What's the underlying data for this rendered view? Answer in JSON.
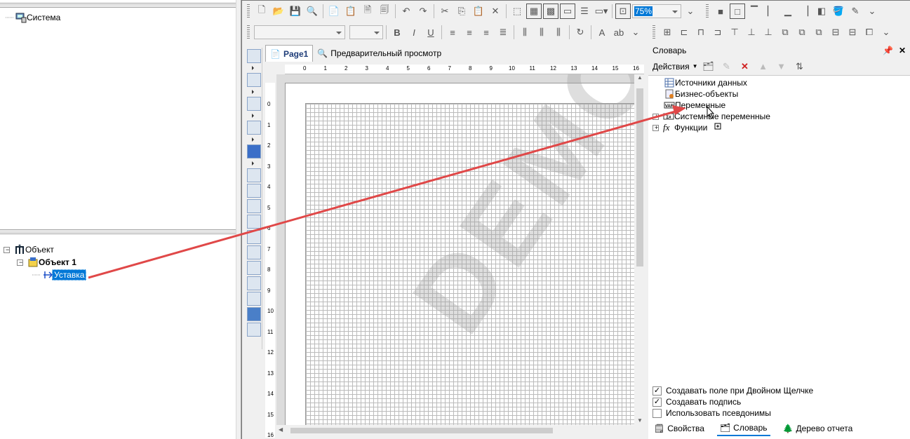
{
  "left_top": {
    "root_label": "Система"
  },
  "left_bottom": {
    "root_label": "Объект",
    "child_label": "Объект 1",
    "leaf_label": "Уставка"
  },
  "toolbar": {
    "zoom_value": "75%"
  },
  "tabs": [
    {
      "label": "Page1"
    },
    {
      "label": "Предварительный просмотр"
    }
  ],
  "ruler": {
    "h_ticks": [
      "0",
      "1",
      "2",
      "3",
      "4",
      "5",
      "6",
      "7",
      "8",
      "9",
      "10",
      "11",
      "12",
      "13",
      "14",
      "15",
      "16"
    ],
    "v_ticks": [
      "0",
      "1",
      "2",
      "3",
      "4",
      "5",
      "6",
      "7",
      "8",
      "9",
      "10",
      "11",
      "12",
      "13",
      "14",
      "15",
      "16"
    ]
  },
  "watermark": "DEMO",
  "dictionary": {
    "title": "Словарь",
    "actions_label": "Действия",
    "items": [
      {
        "label": "Источники данных"
      },
      {
        "label": "Бизнес-объекты"
      },
      {
        "label": "Переменные"
      },
      {
        "label": "Системные переменные"
      },
      {
        "label": "Функции"
      }
    ],
    "options": [
      {
        "label": "Создавать поле при Двойном Щелчке",
        "checked": true
      },
      {
        "label": "Создавать подпись",
        "checked": true
      },
      {
        "label": "Использовать псевдонимы",
        "checked": false
      }
    ],
    "bottom_tabs": [
      {
        "label": "Свойства"
      },
      {
        "label": "Словарь"
      },
      {
        "label": "Дерево отчета"
      }
    ]
  },
  "colors": {
    "accent": "#0078d7",
    "arrow": "#e04848",
    "selection": "#0078d7"
  }
}
